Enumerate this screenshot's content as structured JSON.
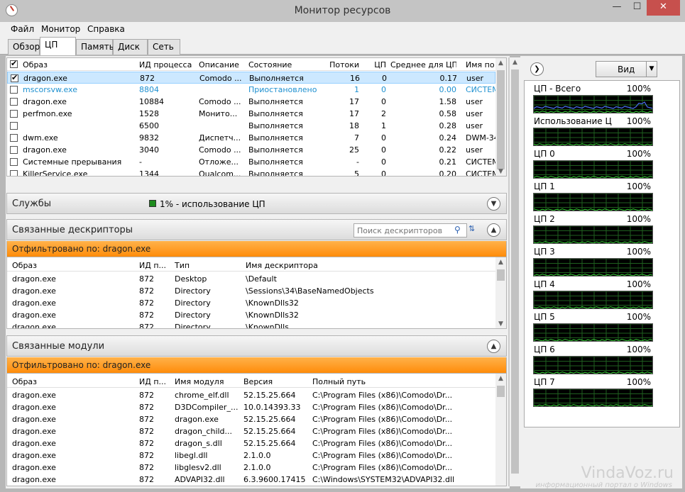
{
  "window": {
    "title": "Монитор ресурсов",
    "minimize": "—",
    "maximize": "☐",
    "close": "✕"
  },
  "menu": [
    "Файл",
    "Монитор",
    "Справка"
  ],
  "tabs": [
    "Обзор",
    "ЦП",
    "Память",
    "Диск",
    "Сеть"
  ],
  "processes": {
    "headers": [
      "Образ",
      "ИД процесса",
      "Описание",
      "Состояние",
      "Потоки",
      "ЦП",
      "Среднее для ЦП",
      "Имя по"
    ],
    "rows": [
      {
        "checked": true,
        "image": "dragon.exe",
        "pid": "872",
        "desc": "Comodo ...",
        "state": "Выполняется",
        "threads": "16",
        "cpu": "0",
        "avg": "0.17",
        "user": "user"
      },
      {
        "checked": false,
        "image": "mscorsvw.exe",
        "pid": "8804",
        "desc": "",
        "state": "Приостановлено",
        "threads": "1",
        "cpu": "0",
        "avg": "0.00",
        "user": "СИСТЕМ"
      },
      {
        "checked": false,
        "image": "dragon.exe",
        "pid": "10884",
        "desc": "Comodo ...",
        "state": "Выполняется",
        "threads": "17",
        "cpu": "0",
        "avg": "1.58",
        "user": "user"
      },
      {
        "checked": false,
        "image": "perfmon.exe",
        "pid": "1528",
        "desc": "Монито...",
        "state": "Выполняется",
        "threads": "17",
        "cpu": "2",
        "avg": "0.58",
        "user": "user"
      },
      {
        "checked": false,
        "image": "",
        "pid": "6500",
        "desc": "",
        "state": "Выполняется",
        "threads": "18",
        "cpu": "1",
        "avg": "0.28",
        "user": "user"
      },
      {
        "checked": false,
        "image": "dwm.exe",
        "pid": "9832",
        "desc": "Диспетч...",
        "state": "Выполняется",
        "threads": "7",
        "cpu": "0",
        "avg": "0.24",
        "user": "DWM-34"
      },
      {
        "checked": false,
        "image": "dragon.exe",
        "pid": "3040",
        "desc": "Comodo ...",
        "state": "Выполняется",
        "threads": "25",
        "cpu": "0",
        "avg": "0.22",
        "user": "user"
      },
      {
        "checked": false,
        "image": "Системные прерывания",
        "pid": "-",
        "desc": "Отложе...",
        "state": "Выполняется",
        "threads": "-",
        "cpu": "0",
        "avg": "0.21",
        "user": "СИСТЕМ"
      },
      {
        "checked": false,
        "image": "KillerService.exe",
        "pid": "1344",
        "desc": "Qualcom...",
        "state": "Выполняется",
        "threads": "5",
        "cpu": "0",
        "avg": "0.20",
        "user": "СИСТЕМ"
      }
    ]
  },
  "services": {
    "title": "Службы",
    "usage": "1% - использование ЦП",
    "usage_color": "#1e8c1e"
  },
  "handles": {
    "title": "Связанные дескрипторы",
    "search_placeholder": "Поиск дескрипторов",
    "filter": "Отфильтровано по: dragon.exe",
    "headers": [
      "Образ",
      "ИД п...",
      "Тип",
      "Имя дескриптора"
    ],
    "rows": [
      {
        "image": "dragon.exe",
        "pid": "872",
        "type": "Desktop",
        "name": "\\Default"
      },
      {
        "image": "dragon.exe",
        "pid": "872",
        "type": "Directory",
        "name": "\\Sessions\\34\\BaseNamedObjects"
      },
      {
        "image": "dragon.exe",
        "pid": "872",
        "type": "Directory",
        "name": "\\KnownDlls32"
      },
      {
        "image": "dragon.exe",
        "pid": "872",
        "type": "Directory",
        "name": "\\KnownDlls32"
      },
      {
        "image": "dragon.exe",
        "pid": "872",
        "type": "Directory",
        "name": "\\KnownDlls"
      }
    ]
  },
  "modules": {
    "title": "Связанные модули",
    "filter": "Отфильтровано по: dragon.exe",
    "headers": [
      "Образ",
      "ИД п...",
      "Имя модуля",
      "Версия",
      "Полный путь"
    ],
    "rows": [
      {
        "image": "dragon.exe",
        "pid": "872",
        "module": "chrome_elf.dll",
        "version": "52.15.25.664",
        "path": "C:\\Program Files (x86)\\Comodo\\Dr..."
      },
      {
        "image": "dragon.exe",
        "pid": "872",
        "module": "D3DCompiler_...",
        "version": "10.0.14393.33",
        "path": "C:\\Program Files (x86)\\Comodo\\Dr..."
      },
      {
        "image": "dragon.exe",
        "pid": "872",
        "module": "dragon.exe",
        "version": "52.15.25.664",
        "path": "C:\\Program Files (x86)\\Comodo\\Dr..."
      },
      {
        "image": "dragon.exe",
        "pid": "872",
        "module": "dragon_child...",
        "version": "52.15.25.664",
        "path": "C:\\Program Files (x86)\\Comodo\\Dr..."
      },
      {
        "image": "dragon.exe",
        "pid": "872",
        "module": "dragon_s.dll",
        "version": "52.15.25.664",
        "path": "C:\\Program Files (x86)\\Comodo\\Dr..."
      },
      {
        "image": "dragon.exe",
        "pid": "872",
        "module": "libegl.dll",
        "version": "2.1.0.0",
        "path": "C:\\Program Files (x86)\\Comodo\\Dr..."
      },
      {
        "image": "dragon.exe",
        "pid": "872",
        "module": "libglesv2.dll",
        "version": "2.1.0.0",
        "path": "C:\\Program Files (x86)\\Comodo\\Dr..."
      },
      {
        "image": "dragon.exe",
        "pid": "872",
        "module": "ADVAPI32.dll",
        "version": "6.3.9600.17415",
        "path": "C:\\Windows\\SYSTEM32\\ADVAPI32.dll"
      }
    ]
  },
  "right": {
    "view_label": "Вид",
    "graphs": [
      {
        "label": "ЦП - Всего",
        "pct": "100%"
      },
      {
        "label": "Использование ЦП сл...",
        "pct": "100%"
      },
      {
        "label": "ЦП 0",
        "pct": "100%"
      },
      {
        "label": "ЦП 1",
        "pct": "100%"
      },
      {
        "label": "ЦП 2",
        "pct": "100%"
      },
      {
        "label": "ЦП 3",
        "pct": "100%"
      },
      {
        "label": "ЦП 4",
        "pct": "100%"
      },
      {
        "label": "ЦП 5",
        "pct": "100%"
      },
      {
        "label": "ЦП 6",
        "pct": "100%"
      },
      {
        "label": "ЦП 7",
        "pct": "100%"
      }
    ]
  },
  "watermark": {
    "main": "VindaVoz.ru",
    "sub": "информационный портал о Windows"
  }
}
